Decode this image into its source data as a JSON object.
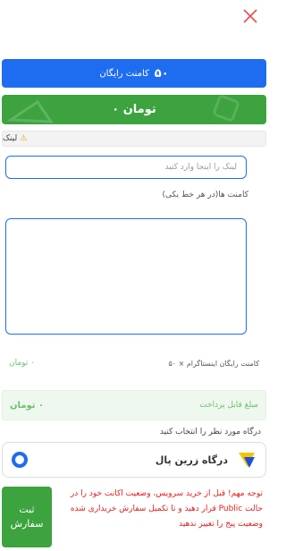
{
  "header": {
    "close_icon": "close-x-icon",
    "accent_color": "#e05050"
  },
  "free_comments": {
    "count": "۵۰",
    "label": "کامنت رایگان",
    "color": "#1e6cf0"
  },
  "price_banner": {
    "text": "۰ تومان",
    "color": "#3ca33f"
  },
  "link_section": {
    "warning_icon": "warning-icon",
    "label": "لینک",
    "input_placeholder": "لینک را اینجا وارد کنید",
    "input_value": ""
  },
  "comments_section": {
    "label": "کامنت ها(در هر خط یکی)",
    "value": ""
  },
  "summary": {
    "description": "کامنت رایگان اینستاگرام × ۵۰",
    "price": "۰ تومان"
  },
  "payable": {
    "label": "مبلغ قابل پرداخت",
    "price": "۰ تومان"
  },
  "gateway": {
    "section_label": "درگاه مورد نظر را انتخاب کنید",
    "name": "درگاه زرین پال",
    "selected": true
  },
  "submit": {
    "label": "ثبت سفارش"
  },
  "notice": {
    "text": "توجه مهم! قبل از خرید سرویس، وضعیت اکانت خود را در حالت Public قرار دهید و تا تکمیل سفارش خریداری شده وضعیت پیج را تغییر ندهید"
  }
}
